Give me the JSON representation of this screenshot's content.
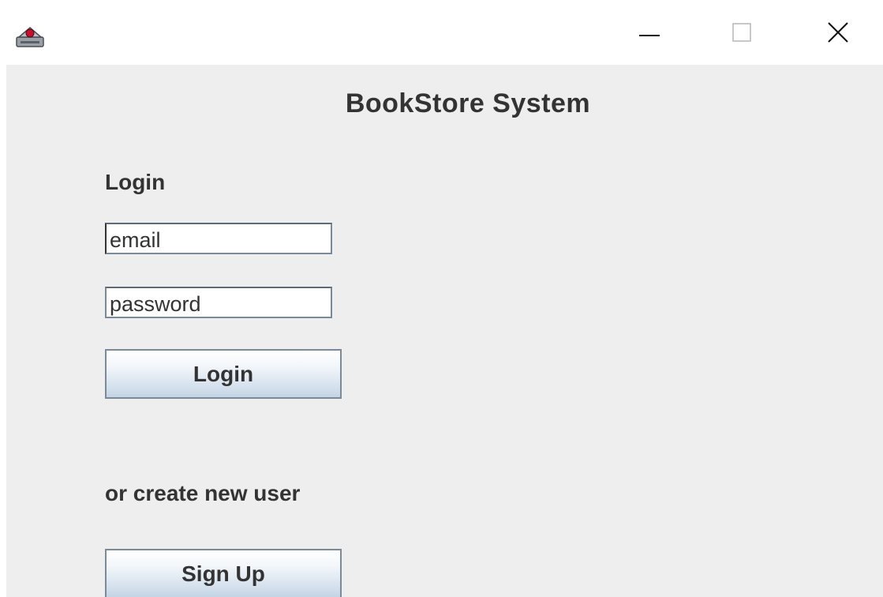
{
  "window": {
    "app_icon": "java-cup-icon",
    "controls": {
      "minimize_icon": "minimize-icon",
      "maximize_icon": "maximize-icon",
      "close_icon": "close-icon"
    }
  },
  "main": {
    "title": "BookStore System",
    "login_section": {
      "label": "Login",
      "email_value": "email",
      "password_value": "password",
      "button_label": "Login"
    },
    "signup_section": {
      "label": "or create new user",
      "button_label": "Sign Up"
    }
  },
  "colors": {
    "panel_background": "#eeeeee",
    "text": "#333333",
    "button_border": "#7a8a99"
  }
}
